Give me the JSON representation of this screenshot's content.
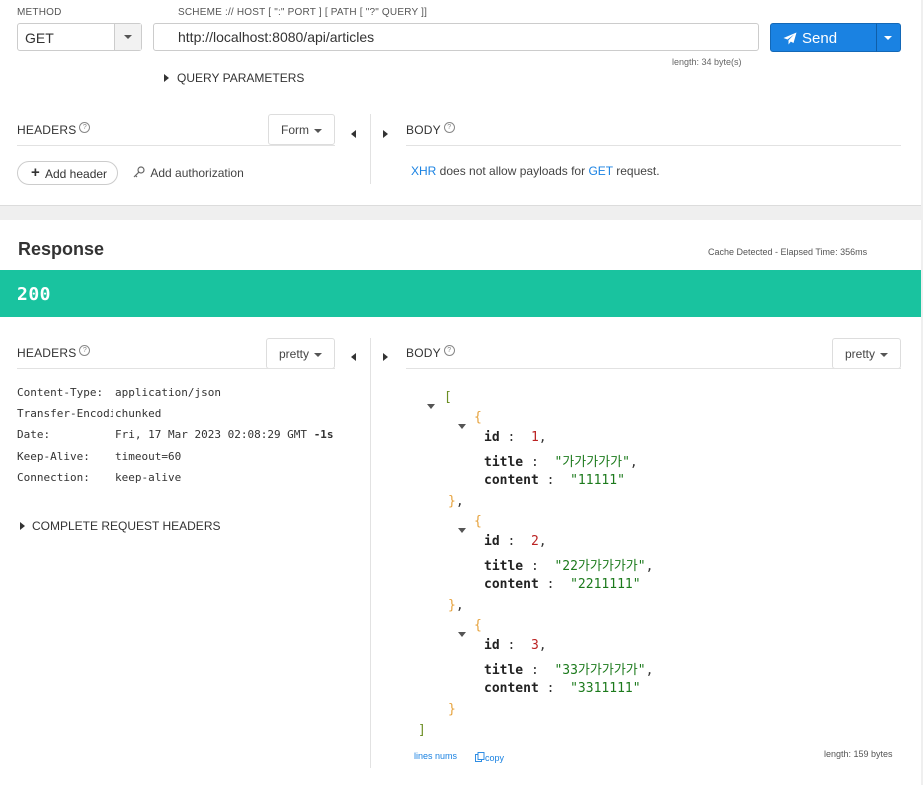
{
  "request": {
    "method_label": "METHOD",
    "method_value": "GET",
    "url_label": "SCHEME :// HOST [ \":\" PORT ] [ PATH [ \"?\" QUERY ]]",
    "url_value": "http://localhost:8080/api/articles",
    "url_length": "length: 34 byte(s)",
    "send_label": "Send",
    "query_params_label": "QUERY PARAMETERS",
    "headers_title": "HEADERS",
    "headers_mode": "Form",
    "body_title": "BODY",
    "add_header_label": "Add header",
    "add_auth_label": "Add authorization",
    "body_notice": {
      "xhr": "XHR",
      "middle": " does not allow payloads for ",
      "method": "GET",
      "end": " request."
    }
  },
  "response": {
    "title": "Response",
    "cache_info": "Cache Detected - Elapsed Time: 356ms",
    "status_code": "200",
    "status_color": "#19c39f",
    "headers_title": "HEADERS",
    "headers_mode": "pretty",
    "body_title": "BODY",
    "body_mode": "pretty",
    "headers": [
      {
        "key": "Content-Type:",
        "value": "application/json"
      },
      {
        "key": "Transfer-Encoding:",
        "value": "chunked"
      },
      {
        "key": "Date:",
        "value": "Fri, 17 Mar 2023 02:08:29 GMT",
        "extra": "‑1s"
      },
      {
        "key": "Keep-Alive:",
        "value": "timeout=60"
      },
      {
        "key": "Connection:",
        "value": "keep-alive"
      }
    ],
    "complete_request_headers": "COMPLETE REQUEST HEADERS",
    "body": {
      "open_bracket": "[",
      "close_bracket": "]",
      "items": [
        {
          "id": "1",
          "title": "\"가가가가가\"",
          "content": "\"11111\""
        },
        {
          "id": "2",
          "title": "\"22가가가가가\"",
          "content": "\"2211111\""
        },
        {
          "id": "3",
          "title": "\"33가가가가가\"",
          "content": "\"3311111\""
        }
      ],
      "key_id": "id",
      "key_title": "title",
      "key_content": "content"
    },
    "lines_nums": "lines nums",
    "copy": "copy",
    "body_length": "length: 159 bytes"
  },
  "colors": {
    "accent": "#1a82e2",
    "status_ok": "#19c39f"
  }
}
